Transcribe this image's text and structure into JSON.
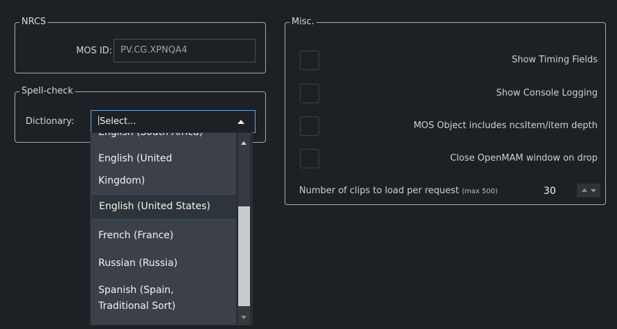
{
  "nrcs": {
    "legend": "NRCS",
    "mos_id_label": "MOS ID:",
    "mos_id_value": "PV.CG.XPNQA4"
  },
  "spell_check": {
    "legend": "Spell-check",
    "dictionary_label": "Dictionary:",
    "dictionary_value": "Select...",
    "options": [
      "English (South Africa)",
      "English (United Kingdom)",
      "English (United States)",
      "French (France)",
      "Russian (Russia)",
      "Spanish (Spain, Traditional Sort)"
    ],
    "option_display": [
      "English (South Africa)",
      "English (United",
      "Kingdom)",
      "English (United States)",
      "French (France)",
      "Russian (Russia)",
      "Spanish (Spain,",
      "Traditional Sort)"
    ]
  },
  "misc": {
    "legend": "Misc.",
    "checkboxes": [
      {
        "label": "Show Timing Fields",
        "checked": false
      },
      {
        "label": "Show Console Logging",
        "checked": false
      },
      {
        "label": "MOS Object includes ncsItem/item depth",
        "checked": false
      },
      {
        "label": "Close OpenMAM window on drop",
        "checked": false
      }
    ],
    "clips_label": "Number of clips to load per request",
    "clips_max_label": "(max 500)",
    "clips_value": "30"
  },
  "colors": {
    "background": "#1d2125",
    "focus_border": "#6ca7d6",
    "dropdown_bg": "#3c4149"
  }
}
